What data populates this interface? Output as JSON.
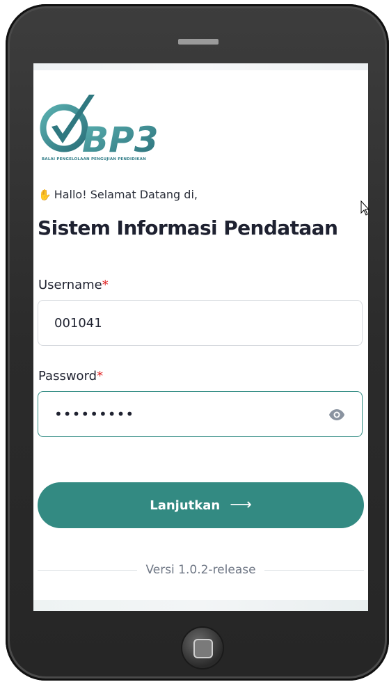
{
  "logo": {
    "text": "BP3",
    "subtitle": "BALAI PENGELOLAAN PENGUJIAN PENDIDIKAN",
    "color": "#2e7b86"
  },
  "greeting": {
    "icon": "waving-hand-icon",
    "text": "Hallo! Selamat Datang di,"
  },
  "title": "Sistem Informasi Pendataan",
  "form": {
    "username_label": "Username",
    "username_value": "001041",
    "password_label": "Password",
    "password_value": "•••••••••",
    "required_mark": "*",
    "submit_label": "Lanjutkan",
    "submit_arrow": "⟶"
  },
  "footer": {
    "version": "Versi 1.0.2-release"
  },
  "colors": {
    "primary": "#338a82",
    "required": "#e02424",
    "text": "#1e2130"
  }
}
